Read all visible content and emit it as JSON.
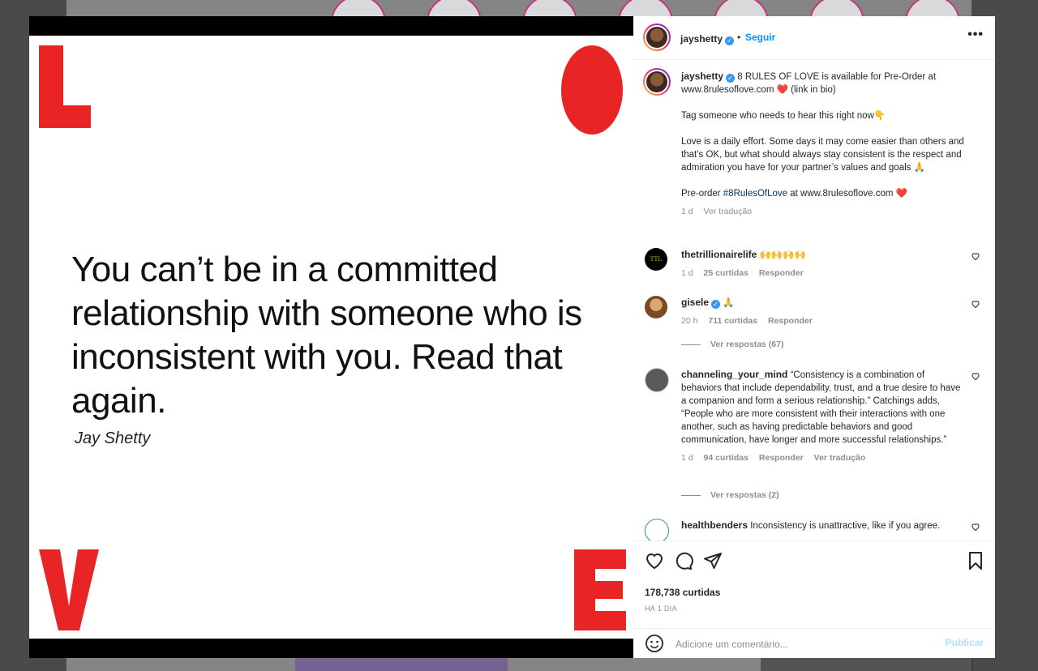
{
  "post": {
    "quote": "You can’t be in a committed relationship with someone who is inconsistent with you. Read that again.",
    "author": "Jay Shetty"
  },
  "header": {
    "username": "jayshetty",
    "verified_mark": "✓",
    "dot": "•",
    "follow_label": "Seguir",
    "more_label": "•••"
  },
  "caption": {
    "username": "jayshetty",
    "line1": "8 RULES OF LOVE is available for Pre-Order at www.8rulesoflove.com",
    "heart": "❤️",
    "line1_end": "(link in bio)",
    "line2": "Tag someone who needs to hear this right now👇",
    "line3": "Love is a daily effort. Some days it may come easier than others and that’s OK, but what should always stay consistent is the respect and admiration you have for your partner’s values and goals 🙏",
    "line4_pre": "Pre-order",
    "hashtag": "#8RulesOfLove",
    "line4_post": "at www.8rulesoflove.com",
    "line4_heart": "❤️",
    "time": "1 d",
    "translate": "Ver tradução"
  },
  "comments": [
    {
      "username": "thetrillionairelife",
      "avatar_text": "TTL",
      "text": "🙌🙌🙌🙌",
      "time": "1 d",
      "likes": "25 curtidas",
      "reply": "Responder"
    },
    {
      "username": "gisele",
      "text": "🙏",
      "time": "20 h",
      "likes": "711 curtidas",
      "reply": "Responder",
      "view_replies": "Ver respostas (67)"
    },
    {
      "username": "channeling_your_mind",
      "text": "“Consistency is a combination of behaviors that include dependability, trust, and a true desire to have a companion and form a serious relationship.” Catchings adds, “People who are more consistent with their interactions with one another, such as having predictable behaviors and good communication, have longer and more successful relationships.”",
      "time": "1 d",
      "likes": "94 curtidas",
      "reply": "Responder",
      "translate": "Ver tradução",
      "view_replies": "Ver respostas (2)"
    },
    {
      "username": "healthbenders",
      "text": "Inconsistency is unattractive, like if you agree."
    }
  ],
  "footer": {
    "likes": "178,738 curtidas",
    "date": "HÁ 1 DIA",
    "comment_placeholder": "Adicione um comentário...",
    "publish_label": "Publicar"
  },
  "colors": {
    "accent_red": "#e82424",
    "link_blue": "#0095f6",
    "verified_blue": "#3897f0"
  }
}
